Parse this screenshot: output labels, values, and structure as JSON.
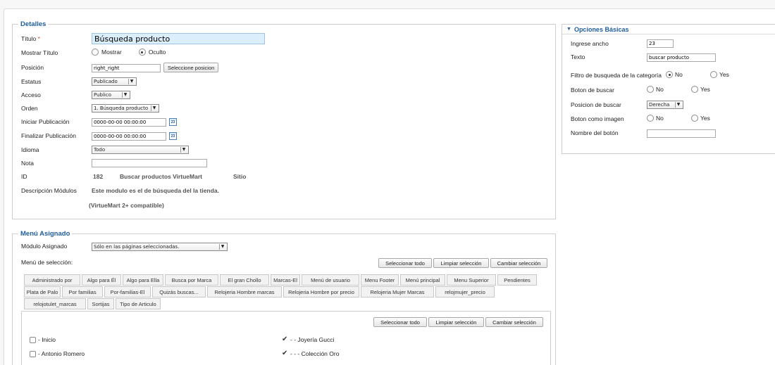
{
  "detalles": {
    "legend": "Detalles",
    "titulo_label": "Título",
    "required_mark": "*",
    "titulo_value": "Búsqueda producto",
    "mostrar_titulo_label": "Mostrar Título",
    "mostrar_option": "Mostrar",
    "oculto_option": "Oculto",
    "mostrar_selected": "Oculto",
    "posicion_label": "Posición",
    "posicion_value": "right_right",
    "seleccione_posicion_btn": "Seleccione posicion",
    "estatus_label": "Estatus",
    "estatus_value": "Publicado",
    "acceso_label": "Acceso",
    "acceso_value": "Publico",
    "orden_label": "Orden",
    "orden_value": "1. Búsqueda producto",
    "iniciar_label": "Iniciar Publicación",
    "iniciar_value": "0000-00-00 00:00:00",
    "finalizar_label": "Finalizar Publicación",
    "finalizar_value": "0000-00-00 00:00:00",
    "idioma_label": "Idioma",
    "idioma_value": "Todo",
    "nota_label": "Nota",
    "nota_value": "",
    "id_label": "ID",
    "id_value": "182",
    "module_name": "Buscar productos VirtueMart",
    "module_site": "Sitio",
    "descripcion_label": "Descripción Módulos",
    "descripcion_value": "Este modulo es el de búsqueda del la tienda.",
    "compat_note": "(VirtueMart 2+ compatible)",
    "calendar_icon_text": "23"
  },
  "opciones": {
    "legend": "Opciones Básicas",
    "ancho_label": "Ingrese ancho",
    "ancho_value": "23",
    "texto_label": "Texto",
    "texto_value": "buscar producto",
    "filtro_label": "Filtro de busqueda de la categoría",
    "boton_buscar_label": "Boton de buscar",
    "posicion_buscar_label": "Posicion de buscar",
    "posicion_buscar_value": "Derecha",
    "boton_imagen_label": "Boton como imagen",
    "nombre_boton_label": "Nombre del botón",
    "nombre_boton_value": "",
    "no_option": "No",
    "yes_option": "Yes",
    "filtro_selected": "No",
    "boton_buscar_selected": "none",
    "boton_imagen_selected": "none"
  },
  "menu": {
    "legend": "Menú Asignado",
    "modulo_asignado_label": "Módulo Asignado",
    "modulo_asignado_value": "Sólo en las páginas seleccionadas.",
    "menu_seleccion_label": "Menú de selección:",
    "select_all": "Seleccionar todo",
    "clear_selection": "Limpiar selección",
    "invert_selection": "Cambiar selección",
    "tabs": [
      "Administrado por",
      "Algo para Él",
      "Algo para Ella",
      "Busca por Marca",
      "El gran Chollo",
      "Marcas-El",
      "Menú de usuario",
      "Menu Footer",
      "Menú principal",
      "Menu Superior",
      "Pendientes",
      "Plata de Palo",
      "Por familias",
      "Por-familias-El",
      "Quizás buscas...",
      "Relojeria Hombre marcas",
      "Relojeria Hombre por precio",
      "Relojeria Mujer Marcas",
      "relojmujer_precio",
      "relojotulet_marcas",
      "Sortijas",
      "Tipo de Articulo"
    ],
    "items_left": [
      {
        "label": "- Inicio",
        "checked": false
      },
      {
        "label": "- Antonio Romero",
        "checked": false
      }
    ],
    "items_right": [
      {
        "label": "- - Joyería Gucci",
        "checked": true
      },
      {
        "label": "- - - Colección Oro",
        "checked": true
      }
    ]
  }
}
